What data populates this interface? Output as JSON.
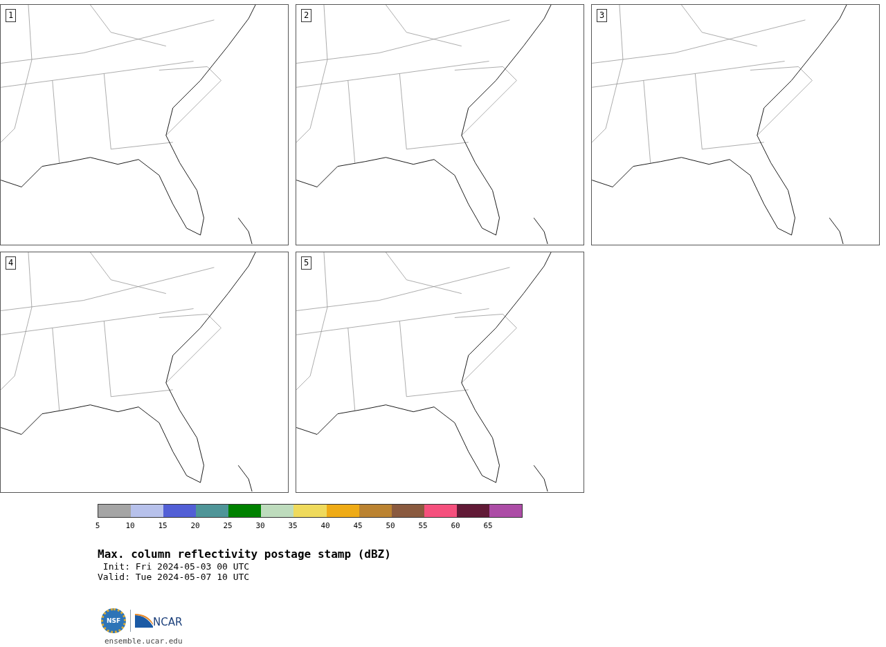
{
  "panels": [
    {
      "number": "1"
    },
    {
      "number": "2"
    },
    {
      "number": "3"
    },
    {
      "number": "4"
    },
    {
      "number": "5"
    }
  ],
  "colorbar": {
    "bins": [
      {
        "color": "#a5a5a5"
      },
      {
        "color": "#b7c1eb"
      },
      {
        "color": "#525fd6"
      },
      {
        "color": "#4f9598"
      },
      {
        "color": "#008100"
      },
      {
        "color": "#bedcbd"
      },
      {
        "color": "#efda5c"
      },
      {
        "color": "#efab16"
      },
      {
        "color": "#bb8331"
      },
      {
        "color": "#8a5a3f"
      },
      {
        "color": "#f5507d"
      },
      {
        "color": "#611a36"
      },
      {
        "color": "#ac4ca6"
      }
    ],
    "ticks": [
      "5",
      "10",
      "15",
      "20",
      "25",
      "30",
      "35",
      "40",
      "45",
      "50",
      "55",
      "60",
      "65"
    ]
  },
  "title": "Max. column reflectivity postage stamp (dBZ)",
  "init": " Init: Fri 2024-05-03 00 UTC",
  "valid": "Valid: Tue 2024-05-07 10 UTC",
  "logos": {
    "nsf": "NSF",
    "ncar": "NCAR"
  },
  "site": "ensemble.ucar.edu"
}
